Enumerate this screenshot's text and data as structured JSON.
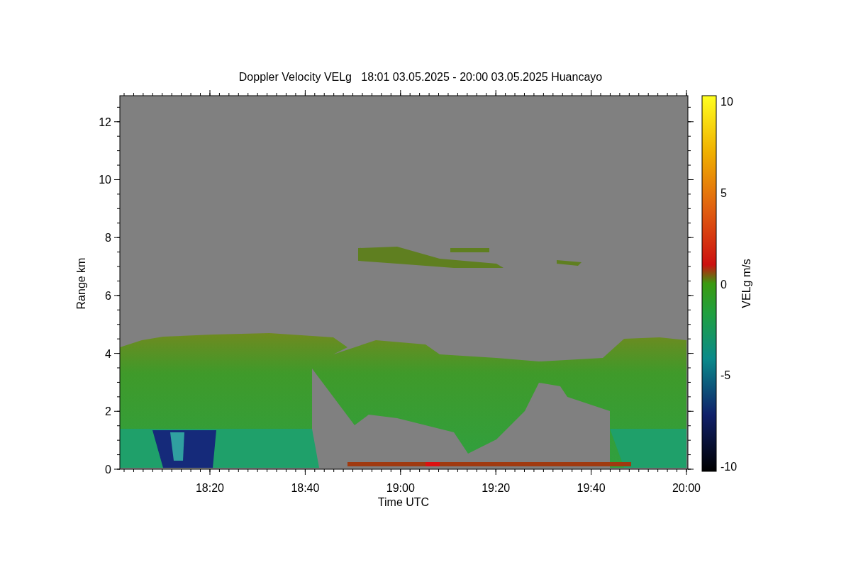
{
  "plot": {
    "title": "Doppler Velocity VELg   18:01 03.05.2025 - 20:00 03.05.2025 Huancayo",
    "x_axis": {
      "label": "Time UTC",
      "ticks": [
        "18:20",
        "18:40",
        "19:00",
        "19:20",
        "19:40",
        "20:00"
      ]
    },
    "y_axis": {
      "label": "Range km",
      "ticks": [
        "12",
        "10",
        "8",
        "6",
        "4",
        "2",
        "0"
      ]
    },
    "colorbar": {
      "label": "VELg m/s",
      "ticks": [
        "10",
        "5",
        "0",
        "-5",
        "-10"
      ]
    }
  }
}
